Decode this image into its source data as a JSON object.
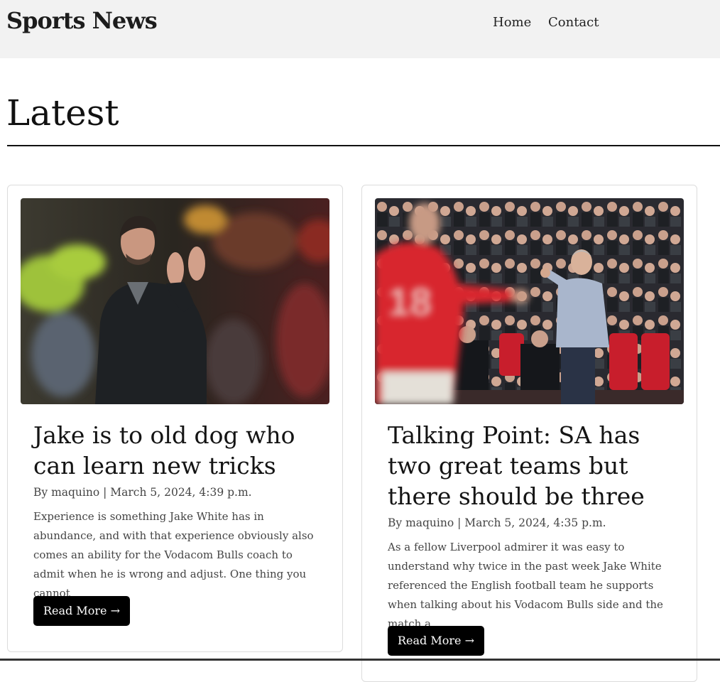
{
  "site": {
    "brand": "Sports News",
    "nav": [
      {
        "label": "Home"
      },
      {
        "label": "Contact"
      }
    ]
  },
  "main": {
    "section_title": "Latest",
    "posts": [
      {
        "title": "Jake is to old dog who can learn new tricks",
        "meta": "By maquino | March 5, 2024, 4:39 p.m.",
        "excerpt": "Experience is something Jake White has in abundance, and with that experience obviously also comes an ability for the Vodacom Bulls coach to admit when he is wrong and adjust. One thing you cannot",
        "button_label": "Read More →"
      },
      {
        "title": "Talking Point: SA has two great teams but there should be three",
        "meta": "By maquino | March 5, 2024, 4:35 p.m.",
        "excerpt": "As a fellow Liverpool admirer it was easy to understand why twice in the past week Jake White referenced the English football team he supports when talking about his Vodacom Bulls side and the match a",
        "button_label": "Read More →"
      }
    ]
  },
  "colors": {
    "navbar_bg": "#f2f2f2",
    "button_bg": "#000000",
    "button_text": "#ffffff",
    "card_border": "#dcdcdc"
  }
}
